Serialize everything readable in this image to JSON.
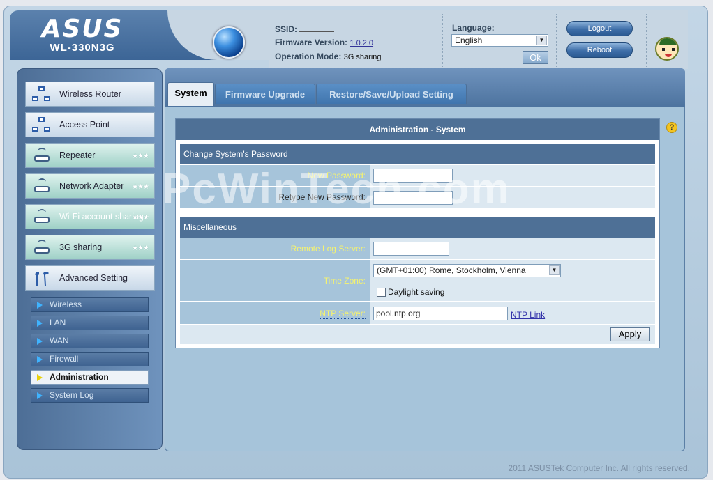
{
  "header": {
    "brand": "ASUS",
    "model": "WL-330N3G",
    "ssid_label": "SSID:",
    "firmware_label": "Firmware Version:",
    "firmware_value": "1.0.2.0",
    "opmode_label": "Operation Mode:",
    "opmode_value": "3G sharing",
    "language_label": "Language:",
    "language_value": "English",
    "ok_label": "Ok",
    "logout_label": "Logout",
    "reboot_label": "Reboot"
  },
  "sidebar": {
    "items": [
      {
        "label": "Wireless Router"
      },
      {
        "label": "Access Point"
      },
      {
        "label": "Repeater"
      },
      {
        "label": "Network Adapter"
      },
      {
        "label": "Wi-Fi account sharing"
      },
      {
        "label": "3G sharing"
      },
      {
        "label": "Advanced Setting"
      }
    ],
    "stars": "★★★",
    "subitems": [
      {
        "label": "Wireless"
      },
      {
        "label": "LAN"
      },
      {
        "label": "WAN"
      },
      {
        "label": "Firewall"
      },
      {
        "label": "Administration"
      },
      {
        "label": "System Log"
      }
    ]
  },
  "tabs": [
    "System",
    "Firmware Upgrade",
    "Restore/Save/Upload Setting"
  ],
  "panel": {
    "title": "Administration - System",
    "password_section": "Change System's Password",
    "new_password_label": "New Password:",
    "retype_password_label": "Retype New Password:",
    "misc_section": "Miscellaneous",
    "remote_log_label": "Remote Log Server:",
    "timezone_label": "Time Zone:",
    "timezone_value": "(GMT+01:00) Rome, Stockholm, Vienna",
    "daylight_label": "Daylight saving",
    "ntp_label": "NTP Server:",
    "ntp_value": "pool.ntp.org",
    "ntp_link": "NTP Link",
    "apply_label": "Apply"
  },
  "watermark": "PcWinTech.com",
  "footer": "2011 ASUSTek Computer Inc. All rights reserved.",
  "colors": {
    "accent": "#4e7096",
    "field_label": "#f6f36e",
    "background": "#a6c4da"
  }
}
